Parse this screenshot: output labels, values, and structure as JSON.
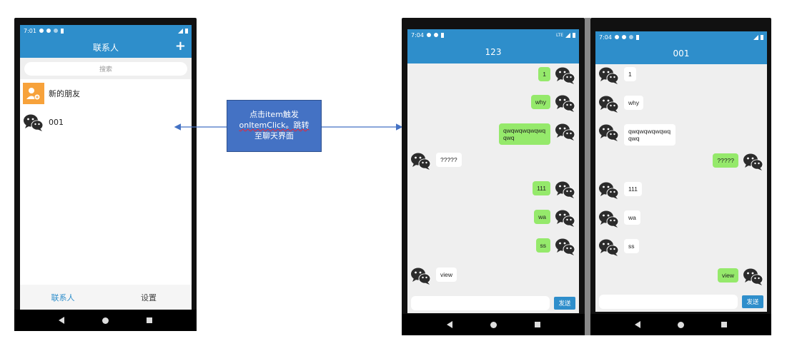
{
  "left_phone": {
    "status_time": "7:01",
    "title": "联系人",
    "add_icon": "plus-icon",
    "search_placeholder": "搜索",
    "contacts": [
      {
        "name": "新的朋友",
        "icon": "new-friend-icon"
      },
      {
        "name": "001",
        "icon": "wechat-avatar-icon"
      }
    ],
    "bottom_tabs": [
      {
        "label": "联系人",
        "active": true
      },
      {
        "label": "设置",
        "active": false
      }
    ]
  },
  "annotation": {
    "line1": "点击item触发",
    "line2": "onItemClick。跳转",
    "line3": "至聊天界面",
    "fill": "#4472c4"
  },
  "chat_phone_1": {
    "status_time": "7:04",
    "status_network": "LTE",
    "title": "123",
    "messages": [
      {
        "text": "1",
        "side": "me"
      },
      {
        "text": "why",
        "side": "me"
      },
      {
        "text": "qwqwqwqwqwqqwq",
        "side": "me"
      },
      {
        "text": "?????",
        "side": "them"
      },
      {
        "text": "111",
        "side": "me"
      },
      {
        "text": "wa",
        "side": "me"
      },
      {
        "text": "ss",
        "side": "me"
      },
      {
        "text": "view",
        "side": "them"
      }
    ],
    "send_label": "发送"
  },
  "chat_phone_2": {
    "status_time": "7:04",
    "title": "001",
    "messages": [
      {
        "text": "1",
        "side": "them"
      },
      {
        "text": "why",
        "side": "them"
      },
      {
        "text": "qwqwqwqwqwqqwq",
        "side": "them"
      },
      {
        "text": "?????",
        "side": "me"
      },
      {
        "text": "111",
        "side": "them"
      },
      {
        "text": "wa",
        "side": "them"
      },
      {
        "text": "ss",
        "side": "them"
      },
      {
        "text": "view",
        "side": "me"
      }
    ],
    "send_label": "发送"
  },
  "colors": {
    "app_bar": "#2e8ecb",
    "my_bubble": "#95e96b",
    "their_bubble": "#ffffff",
    "chat_bg": "#efefef",
    "arrow": "#4472c4"
  }
}
